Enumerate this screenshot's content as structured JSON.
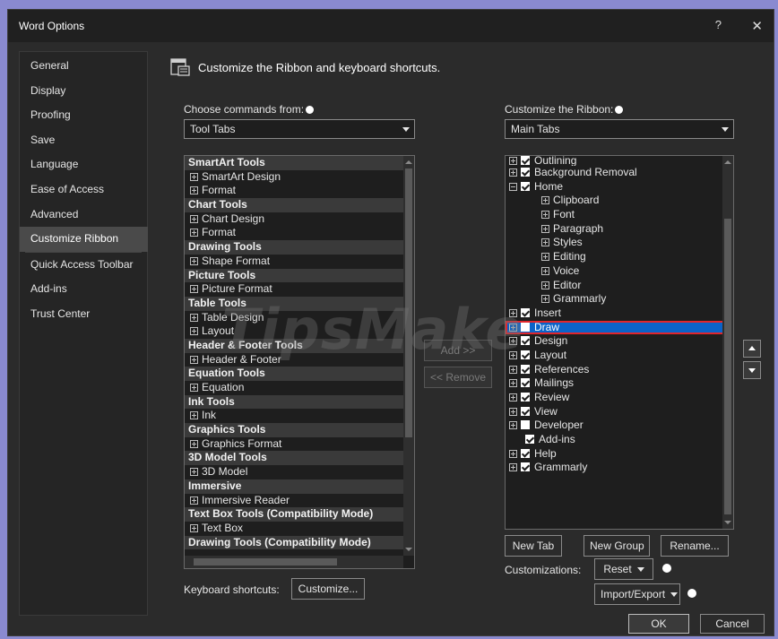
{
  "window": {
    "title": "Word Options",
    "help": "?",
    "close": "✕"
  },
  "nav": {
    "items": [
      {
        "label": "General",
        "name": "nav-general"
      },
      {
        "label": "Display",
        "name": "nav-display"
      },
      {
        "label": "Proofing",
        "name": "nav-proofing"
      },
      {
        "label": "Save",
        "name": "nav-save"
      },
      {
        "label": "Language",
        "name": "nav-language"
      },
      {
        "label": "Ease of Access",
        "name": "nav-ease-of-access"
      },
      {
        "label": "Advanced",
        "name": "nav-advanced"
      },
      {
        "label": "Customize Ribbon",
        "name": "nav-customize-ribbon",
        "selected": true
      },
      {
        "label": "Quick Access Toolbar",
        "name": "nav-quick-access-toolbar"
      },
      {
        "label": "Add-ins",
        "name": "nav-add-ins"
      },
      {
        "label": "Trust Center",
        "name": "nav-trust-center"
      }
    ]
  },
  "main": {
    "heading": "Customize the Ribbon and keyboard shortcuts.",
    "choose_label": "Choose commands from:",
    "choose_value": "Tool Tabs",
    "customize_label": "Customize the Ribbon:",
    "customize_value": "Main Tabs",
    "left_list": [
      {
        "text": "SmartArt Tools",
        "type": "group"
      },
      {
        "text": "SmartArt Design",
        "type": "item"
      },
      {
        "text": "Format",
        "type": "item"
      },
      {
        "text": "Chart Tools",
        "type": "group"
      },
      {
        "text": "Chart Design",
        "type": "item"
      },
      {
        "text": "Format",
        "type": "item"
      },
      {
        "text": "Drawing Tools",
        "type": "group"
      },
      {
        "text": "Shape Format",
        "type": "item"
      },
      {
        "text": "Picture Tools",
        "type": "group"
      },
      {
        "text": "Picture Format",
        "type": "item"
      },
      {
        "text": "Table Tools",
        "type": "group"
      },
      {
        "text": "Table Design",
        "type": "item"
      },
      {
        "text": "Layout",
        "type": "item"
      },
      {
        "text": "Header & Footer Tools",
        "type": "group"
      },
      {
        "text": "Header & Footer",
        "type": "item"
      },
      {
        "text": "Equation Tools",
        "type": "group"
      },
      {
        "text": "Equation",
        "type": "item"
      },
      {
        "text": "Ink Tools",
        "type": "group"
      },
      {
        "text": "Ink",
        "type": "item"
      },
      {
        "text": "Graphics Tools",
        "type": "group"
      },
      {
        "text": "Graphics Format",
        "type": "item"
      },
      {
        "text": "3D Model Tools",
        "type": "group"
      },
      {
        "text": "3D Model",
        "type": "item"
      },
      {
        "text": "Immersive",
        "type": "group"
      },
      {
        "text": "Immersive Reader",
        "type": "item"
      },
      {
        "text": "Text Box Tools (Compatibility Mode)",
        "type": "group"
      },
      {
        "text": "Text Box",
        "type": "item"
      },
      {
        "text": "Drawing Tools (Compatibility Mode)",
        "type": "group"
      }
    ],
    "right_list": [
      {
        "text": "Outlining",
        "level": 0,
        "expander": "plus",
        "checked": true,
        "partial": true
      },
      {
        "text": "Background Removal",
        "level": 0,
        "expander": "plus",
        "checked": true
      },
      {
        "text": "Home",
        "level": 0,
        "expander": "minus",
        "checked": true
      },
      {
        "text": "Clipboard",
        "level": 1,
        "expander": "plus"
      },
      {
        "text": "Font",
        "level": 1,
        "expander": "plus"
      },
      {
        "text": "Paragraph",
        "level": 1,
        "expander": "plus"
      },
      {
        "text": "Styles",
        "level": 1,
        "expander": "plus"
      },
      {
        "text": "Editing",
        "level": 1,
        "expander": "plus"
      },
      {
        "text": "Voice",
        "level": 1,
        "expander": "plus"
      },
      {
        "text": "Editor",
        "level": 1,
        "expander": "plus"
      },
      {
        "text": "Grammarly",
        "level": 1,
        "expander": "plus"
      },
      {
        "text": "Insert",
        "level": 0,
        "expander": "plus",
        "checked": true
      },
      {
        "text": "Draw",
        "level": 0,
        "expander": "plus",
        "checked": false,
        "selected": true
      },
      {
        "text": "Design",
        "level": 0,
        "expander": "plus",
        "checked": true
      },
      {
        "text": "Layout",
        "level": 0,
        "expander": "plus",
        "checked": true
      },
      {
        "text": "References",
        "level": 0,
        "expander": "plus",
        "checked": true
      },
      {
        "text": "Mailings",
        "level": 0,
        "expander": "plus",
        "checked": true
      },
      {
        "text": "Review",
        "level": 0,
        "expander": "plus",
        "checked": true
      },
      {
        "text": "View",
        "level": 0,
        "expander": "plus",
        "checked": true
      },
      {
        "text": "Developer",
        "level": 0,
        "expander": "plus",
        "checked": false
      },
      {
        "text": "Add-ins",
        "level": 0,
        "expander": "none",
        "checked": true
      },
      {
        "text": "Help",
        "level": 0,
        "expander": "plus",
        "checked": true
      },
      {
        "text": "Grammarly",
        "level": 0,
        "expander": "plus",
        "checked": true
      }
    ],
    "add_label": "Add >>",
    "remove_label": "<< Remove",
    "new_tab_label": "New Tab",
    "new_group_label": "New Group",
    "rename_label": "Rename...",
    "customizations_label": "Customizations:",
    "reset_label": "Reset",
    "import_export_label": "Import/Export",
    "keyboard_label": "Keyboard shortcuts:",
    "customize_btn_label": "Customize..."
  },
  "footer": {
    "ok_label": "OK",
    "cancel_label": "Cancel"
  },
  "watermark": "TipsMake",
  "colors": {
    "selection": "#0a63c9",
    "highlight_border": "#e0262c",
    "background": "#2b2b2b"
  }
}
